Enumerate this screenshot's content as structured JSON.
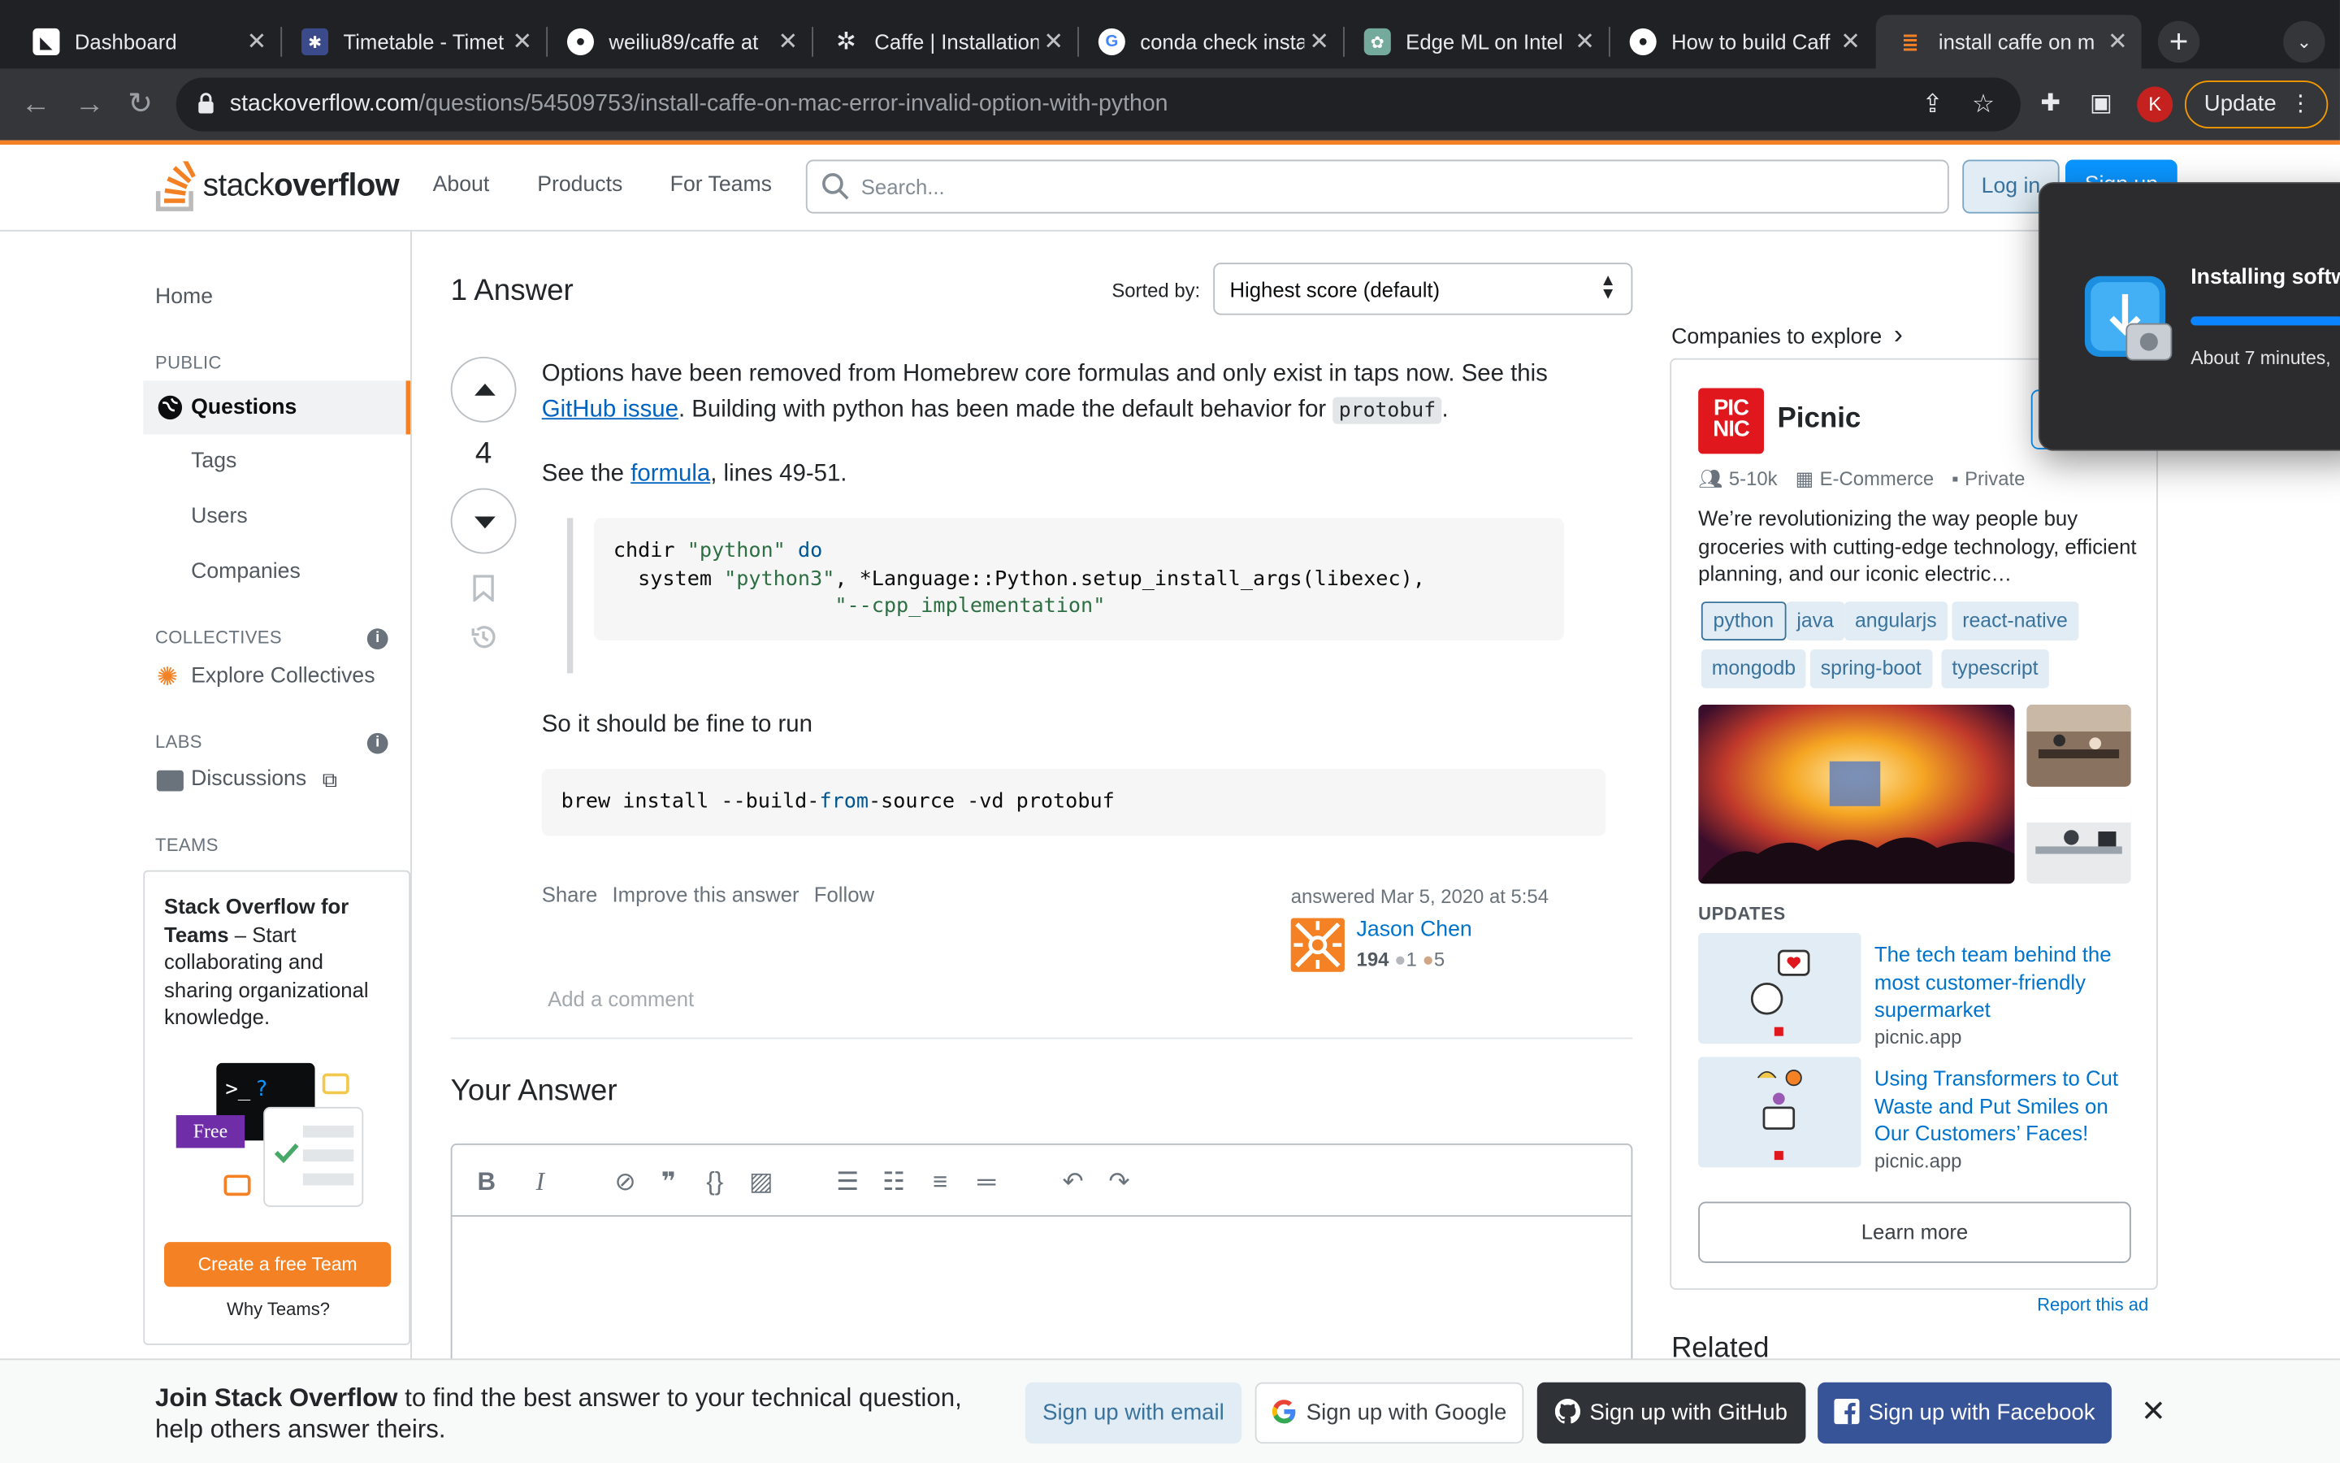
{
  "browser": {
    "tabs": [
      {
        "label": "Dashboard"
      },
      {
        "label": "Timetable - Timet"
      },
      {
        "label": "weiliu89/caffe at"
      },
      {
        "label": "Caffe | Installation"
      },
      {
        "label": "conda check insta"
      },
      {
        "label": "Edge ML on Intel"
      },
      {
        "label": "How to build Caff"
      },
      {
        "label": "install caffe on m"
      }
    ],
    "url_host": "stackoverflow.com",
    "url_path": "/questions/54509753/install-caffe-on-mac-error-invalid-option-with-python",
    "profile_initial": "K",
    "update_label": "Update"
  },
  "so_header": {
    "logo_light": "stack",
    "logo_bold": "overflow",
    "nav": [
      "About",
      "Products",
      "For Teams"
    ],
    "search_placeholder": "Search...",
    "login": "Log in",
    "signup": "Sign up"
  },
  "left_sidebar": {
    "home": "Home",
    "public_heading": "PUBLIC",
    "questions": "Questions",
    "tags": "Tags",
    "users": "Users",
    "companies": "Companies",
    "collectives_heading": "COLLECTIVES",
    "explore_collectives": "Explore Collectives",
    "labs_heading": "LABS",
    "discussions": "Discussions",
    "teams_heading": "TEAMS",
    "teams_title": "Stack Overflow for Teams",
    "teams_desc": " – Start collaborating and sharing organizational knowledge.",
    "teams_free": "Free",
    "create_team": "Create a free Team",
    "why_teams": "Why Teams?"
  },
  "main": {
    "answer_count": "1 Answer",
    "sorted_by": "Sorted by:",
    "sort_value": "Highest score (default)",
    "vote_count": "4",
    "p1_a": "Options have been removed from Homebrew core formulas and only exist in taps now. See this ",
    "p1_link": "GitHub issue",
    "p1_b": ". Building with python has been made the default behavior for ",
    "p1_code": "protobuf",
    "p1_c": ".",
    "p2_a": "See the ",
    "p2_link": "formula",
    "p2_b": ", lines 49-51.",
    "code1_l1_a": "chdir ",
    "code1_l1_str": "\"python\"",
    "code1_l1_kw": " do",
    "code1_l2_a": "  system ",
    "code1_l2_str": "\"python3\"",
    "code1_l2_b": ", *Language::Python.setup_install_args(libexec),",
    "code1_l3_pad": "                  ",
    "code1_l3_str": "\"--cpp_implementation\"",
    "p3": "So it should be fine to run",
    "code2_a": "brew install --build-",
    "code2_kw": "from",
    "code2_b": "-source -vd protobuf",
    "actions": [
      "Share",
      "Improve this answer",
      "Follow"
    ],
    "answered": "answered Mar 5, 2020 at 5:54",
    "user_name": "Jason Chen",
    "user_rep": "194",
    "user_silver": "1",
    "user_bronze": "5",
    "add_comment": "Add a comment",
    "your_answer": "Your Answer"
  },
  "right_sidebar": {
    "companies_to_explore": "Companies to explore",
    "company_name": "Picnic",
    "logo_text_1": "PIC",
    "logo_text_2": "NIC",
    "size": "5-10k",
    "industry": "E-Commerce",
    "ownership": "Private",
    "description": "We’re revolutionizing the way people buy groceries with cutting-edge technology, efficient planning, and our iconic electric…",
    "tags": [
      "python",
      "java",
      "angularjs",
      "react-native",
      "mongodb",
      "spring-boot",
      "typescript"
    ],
    "updates_heading": "UPDATES",
    "update1_title": "The tech team behind the most customer-friendly supermarket",
    "update1_src": "picnic.app",
    "update2_title": "Using Transformers to Cut Waste and Put Smiles on Our Customers’ Faces!",
    "update2_src": "picnic.app",
    "learn_more": "Learn more",
    "report_ad": "Report this ad",
    "related": "Related"
  },
  "install_popup": {
    "title": "Installing softw",
    "subtitle": "About 7 minutes,",
    "progress": 0.85,
    "accent": "#0a84ff"
  },
  "banner": {
    "bold": "Join Stack Overflow",
    "text": " to find the best answer to your technical question, help others answer theirs.",
    "email": "Sign up with email",
    "google": "Sign up with Google",
    "github": "Sign up with GitHub",
    "facebook": "Sign up with Facebook"
  },
  "colors": {
    "so_orange": "#f48225",
    "so_blue": "#0a95ff",
    "link": "#0063bf"
  }
}
